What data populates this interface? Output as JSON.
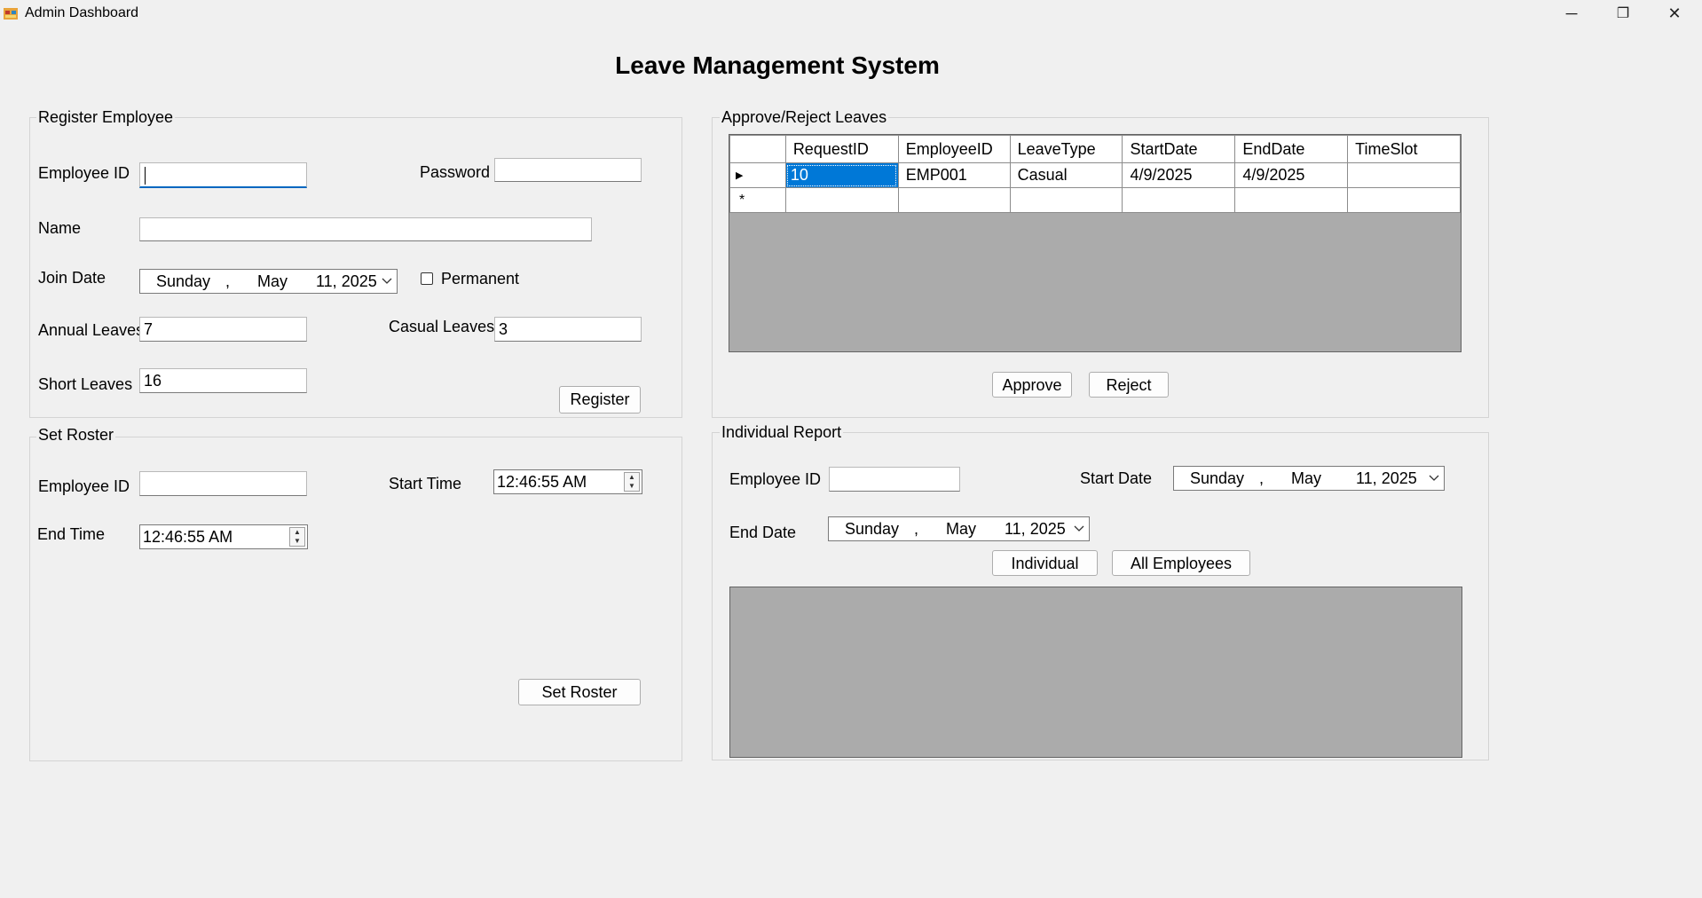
{
  "window": {
    "title": "Admin Dashboard",
    "minimize": "─",
    "restore": "❐",
    "close": "✕"
  },
  "main_title": "Leave Management System",
  "register": {
    "legend": "Register Employee",
    "employee_id_label": "Employee ID",
    "employee_id_value": "",
    "password_label": "Password",
    "password_value": "",
    "name_label": "Name",
    "name_value": "",
    "join_date_label": "Join Date",
    "join_date": {
      "day": "Sunday",
      "sep": ",",
      "month": "May",
      "date": "11, 2025"
    },
    "permanent_label": "Permanent",
    "permanent_checked": false,
    "annual_label": "Annual Leaves",
    "annual_value": "7",
    "casual_label": "Casual Leaves",
    "casual_value": "3",
    "short_label": "Short Leaves",
    "short_value": "16",
    "register_button": "Register"
  },
  "roster": {
    "legend": "Set Roster",
    "employee_id_label": "Employee ID",
    "employee_id_value": "",
    "start_time_label": "Start Time",
    "start_time_value": "12:46:55 AM",
    "end_time_label": "End Time",
    "end_time_value": "12:46:55 AM",
    "set_button": "Set  Roster"
  },
  "approve": {
    "legend": "Approve/Reject Leaves",
    "columns": [
      "RequestID",
      "EmployeeID",
      "LeaveType",
      "StartDate",
      "EndDate",
      "TimeSlot"
    ],
    "rows": [
      {
        "marker": "▶",
        "cells": [
          "10",
          "EMP001",
          "Casual",
          "4/9/2025",
          "4/9/2025",
          ""
        ]
      }
    ],
    "new_row_marker": "*",
    "approve_button": "Approve",
    "reject_button": "Reject"
  },
  "report": {
    "legend": "Individual Report",
    "employee_id_label": "Employee ID",
    "employee_id_value": "",
    "start_date_label": "Start Date",
    "start_date": {
      "day": "Sunday",
      "sep": ",",
      "month": "May",
      "date": "11, 2025"
    },
    "end_date_label": "End Date",
    "end_date": {
      "day": "Sunday",
      "sep": ",",
      "month": "May",
      "date": "11, 2025"
    },
    "individual_button": "Individual",
    "all_button": "All Employees"
  }
}
